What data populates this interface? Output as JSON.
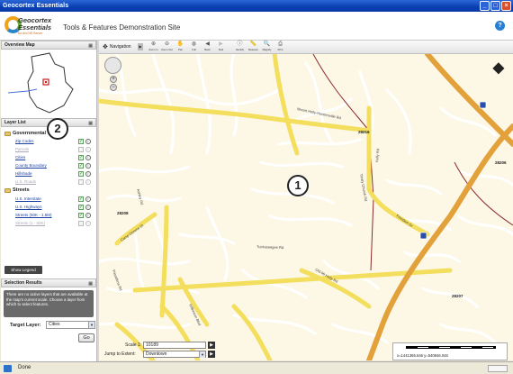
{
  "window": {
    "title": "Geocortex Essentials"
  },
  "header": {
    "logo_line1": "Geocortex",
    "logo_line2": "Essentials",
    "logo_sub": "for ArcGIS Server",
    "site_title": "Tools & Features Demonstration Site"
  },
  "overview_panel": {
    "title": "Overview Map"
  },
  "layer_panel": {
    "title": "Layer List",
    "groups": [
      {
        "name": "Governmental",
        "layers": [
          {
            "name": "Zip Codes",
            "visible": true
          },
          {
            "name": "Parcels",
            "visible": false
          },
          {
            "name": "Cities",
            "visible": true
          },
          {
            "name": "County Boundary",
            "visible": true
          },
          {
            "name": "Hillshade",
            "visible": true
          },
          {
            "name": "U.S. Roads",
            "visible": false
          }
        ]
      },
      {
        "name": "Streets",
        "layers": [
          {
            "name": "U.S. Interstate",
            "visible": true
          },
          {
            "name": "U.S. Highways",
            "visible": true
          },
          {
            "name": "Streets (50K - 1.5M)",
            "visible": true
          },
          {
            "name": "Streets (1 - 50K)",
            "visible": false
          }
        ]
      }
    ],
    "legend_button": "Show Legend"
  },
  "results_panel": {
    "title": "Selection Results",
    "message": "There are no active layers that are available at the map's current scale. Choose a layer from which to select features.",
    "target_label": "Target Layer:",
    "target_value": "Cities",
    "go_label": "Go"
  },
  "toolbar": {
    "nav_label": "Navigation",
    "tools": [
      "Zoom In",
      "Zoom Out",
      "Pan",
      "Full",
      "Back",
      "Fwd",
      "Identify",
      "Measure",
      "Magnify",
      "Print"
    ]
  },
  "map": {
    "roads": [
      "Mount Holly-Huntersville Rd",
      "Kelly Rd",
      "Trinity Church Rd",
      "Tuckaseegee Rd",
      "Camp Greene St",
      "Ashley Rd",
      "Old Mt Holly Rd",
      "Wilkinson Blvd",
      "Freedom Dr",
      "Pasadena Rd",
      "Toddville Rd",
      "Trinity Ct",
      "Beatties Ford Rd",
      "Berryhill Rd"
    ],
    "zip_labels": [
      "28216",
      "28214",
      "28208",
      "28206",
      "28207"
    ],
    "shields": [
      "85",
      "77"
    ],
    "callout_1": "1",
    "callout_2": "2"
  },
  "map_controls": {
    "scale_label": "Scale 1:",
    "scale_value": "10189",
    "jump_label": "Jump to Extent:",
    "jump_value": "Downtown"
  },
  "scalebar": {
    "ticks": [
      "0",
      "500",
      "1000",
      "1500",
      "2000ft"
    ],
    "coords": "x=1441365.646 y=540846.046"
  },
  "statusbar": {
    "text": "Done"
  },
  "colors": {
    "road_major": "#f5e36b",
    "road_minor": "#ffffff",
    "boundary": "#8b2a2a",
    "highway": "#e0a33a"
  }
}
